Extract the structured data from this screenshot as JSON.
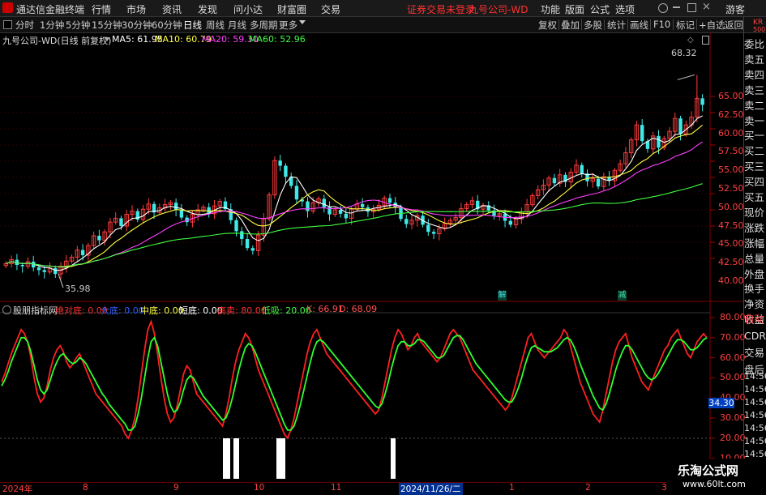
{
  "menubar": {
    "app_title": "通达信金融终端",
    "items": [
      "行情",
      "市场",
      "资讯",
      "发现",
      "问小达",
      "财富圈",
      "交易"
    ],
    "center_notice": "证券交易未登录",
    "center_stock": "九号公司-WD",
    "right_items": [
      "功能",
      "版面",
      "公式",
      "选项"
    ],
    "guest": "游客"
  },
  "toolbar": {
    "periods": [
      "分时",
      "1分钟",
      "5分钟",
      "15分钟",
      "30分钟",
      "60分钟",
      "日线",
      "周线",
      "月线",
      "多周期",
      "更多"
    ],
    "active_period": "日线",
    "right_buttons": [
      "复权",
      "叠加",
      "多股",
      "统计",
      "画线",
      "F10",
      "标记",
      "+自选",
      "返回"
    ]
  },
  "chart_header": {
    "stock": "九号公司-WD(日线 前复权)",
    "ma": [
      {
        "label": "MA5: 61.95",
        "color": "#ffffff"
      },
      {
        "label": "MA10: 60.79",
        "color": "#ffff40"
      },
      {
        "label": "MA20: 59.30",
        "color": "#ff40ff"
      },
      {
        "label": "MA60: 52.96",
        "color": "#40ff40"
      }
    ]
  },
  "indicator_header": {
    "name": "股朋指标网",
    "items": [
      {
        "label": "绝对底: 0.00",
        "color": "#ff3030"
      },
      {
        "label": "大底: 0.00",
        "color": "#3060ff"
      },
      {
        "label": "中底: 0.00",
        "color": "#ffff40"
      },
      {
        "label": "短底: 0.00",
        "color": "#ffffff"
      },
      {
        "label": "高卖: 80.00",
        "color": "#ff3030"
      },
      {
        "label": "低吸: 20.00",
        "color": "#40ff40"
      },
      {
        "label": "K: 66.91",
        "color": "#ff5050"
      },
      {
        "label": "D: 68.09",
        "color": "#ff5050"
      }
    ]
  },
  "price_axis": {
    "labels": [
      "65.00",
      "62.50",
      "60.00",
      "57.50",
      "55.00",
      "52.50",
      "50.00",
      "47.50",
      "45.00",
      "42.50",
      "40.00"
    ],
    "max_price_label": "68.32",
    "min_price_label": "35.98"
  },
  "indicator_axis": {
    "labels": [
      "80.00",
      "70.00",
      "60.00",
      "50.00",
      "40.00",
      "30.00",
      "20.00",
      "10.00"
    ],
    "current_value": "34.30"
  },
  "x_axis": {
    "labels": [
      "2024年",
      "8",
      "9",
      "10",
      "11",
      "2024/11/26/二",
      "1",
      "2",
      "3"
    ]
  },
  "event_marks": [
    "解",
    "减"
  ],
  "side_panel": {
    "top_code": "KR",
    "top_sub": "500",
    "items": [
      "委比",
      "卖五",
      "卖四",
      "卖三",
      "卖二",
      "卖一",
      "买一",
      "买二",
      "买三",
      "买四",
      "买五",
      "现价",
      "涨跌",
      "涨幅",
      "总量",
      "外盘",
      "换手",
      "净资",
      "收益"
    ],
    "lower": [
      "自动",
      "CDR",
      "交易",
      "盘后"
    ],
    "times": [
      "14:56",
      "14:56",
      "14:56",
      "14:56",
      "14:56",
      "14:56",
      "14:56",
      "14:56"
    ]
  },
  "watermark": {
    "title": "乐淘公式网",
    "url": "www.60lt.com"
  },
  "chart_data": {
    "type": "candlestick",
    "price_range": [
      35.98,
      68.32
    ],
    "candles_close": [
      39.2,
      39.8,
      39.0,
      38.8,
      39.5,
      38.6,
      38.2,
      37.9,
      38.5,
      37.6,
      38.8,
      39.6,
      40.2,
      41.3,
      40.5,
      42.0,
      43.5,
      42.8,
      44.1,
      45.6,
      46.2,
      45.0,
      46.8,
      47.3,
      46.0,
      47.6,
      48.4,
      47.1,
      47.8,
      48.3,
      48.6,
      47.5,
      46.3,
      45.6,
      46.8,
      47.5,
      47.9,
      46.9,
      48.1,
      48.8,
      47.6,
      45.9,
      44.2,
      43.0,
      41.6,
      41.2,
      43.6,
      46.1,
      49.8,
      55.1,
      54.3,
      52.6,
      51.2,
      49.1,
      48.8,
      47.3,
      48.6,
      49.2,
      47.9,
      46.8,
      47.5,
      46.9,
      46.2,
      47.6,
      48.4,
      47.9,
      47.2,
      47.6,
      48.2,
      49.3,
      48.6,
      47.9,
      46.1,
      45.3,
      45.9,
      46.6,
      45.2,
      44.1,
      43.8,
      44.6,
      45.4,
      45.9,
      46.3,
      47.7,
      48.3,
      48.9,
      47.6,
      48.2,
      47.4,
      46.6,
      46.9,
      45.8,
      45.2,
      46.1,
      47.2,
      48.3,
      49.7,
      50.6,
      51.3,
      52.4,
      51.6,
      52.9,
      51.8,
      53.3,
      54.4,
      53.1,
      51.9,
      52.3,
      51.1,
      52.6,
      52.0,
      53.6,
      54.6,
      56.3,
      58.3,
      60.6,
      58.1,
      56.9,
      58.9,
      57.1,
      58.5,
      59.6,
      61.6,
      59.2,
      60.6,
      61.8,
      64.7,
      63.7
    ],
    "indicator_range": [
      10,
      80
    ],
    "k_values": [
      48,
      52,
      57,
      62,
      66,
      70,
      74,
      72,
      68,
      60,
      50,
      42,
      38,
      40,
      46,
      54,
      60,
      64,
      66,
      63,
      58,
      55,
      57,
      60,
      62,
      58,
      54,
      50,
      46,
      42,
      40,
      38,
      36,
      34,
      32,
      30,
      28,
      26,
      22,
      20,
      24,
      30,
      40,
      52,
      64,
      74,
      78,
      72,
      62,
      50,
      40,
      32,
      28,
      30,
      36,
      44,
      52,
      56,
      54,
      48,
      42,
      40,
      38,
      36,
      34,
      32,
      30,
      28,
      26,
      32,
      40,
      50,
      58,
      64,
      68,
      72,
      70,
      66,
      60,
      54,
      50,
      46,
      42,
      38,
      34,
      30,
      26,
      22,
      20,
      24,
      30,
      38,
      46,
      54,
      62,
      68,
      72,
      74,
      70,
      66,
      62,
      60,
      58,
      56,
      54,
      52,
      50,
      48,
      46,
      44,
      42,
      40,
      38,
      36,
      34,
      32,
      34,
      40,
      48,
      56,
      64,
      70,
      74,
      72,
      68,
      64,
      66,
      70,
      72,
      68,
      66,
      64,
      62,
      60,
      58,
      60,
      64,
      68,
      72,
      74,
      72,
      70,
      66,
      62,
      58,
      54,
      52,
      50,
      48,
      46,
      44,
      42,
      40,
      38,
      36,
      34,
      36,
      40,
      46,
      52,
      58,
      64,
      70,
      72,
      68,
      64,
      62,
      60,
      62,
      64,
      66,
      68,
      70,
      74,
      72,
      66,
      60,
      54,
      48,
      44,
      40,
      36,
      32,
      30,
      28,
      34,
      42,
      50,
      58,
      64,
      68,
      70,
      72,
      66,
      60,
      56,
      52,
      48,
      46,
      44,
      48,
      52,
      56,
      60,
      64,
      66,
      70,
      72,
      74,
      70,
      66,
      62,
      60,
      64,
      68,
      70,
      72,
      70
    ],
    "d_values": [
      46,
      49,
      53,
      58,
      62,
      66,
      70,
      70,
      68,
      63,
      56,
      49,
      44,
      42,
      44,
      49,
      54,
      58,
      61,
      62,
      60,
      58,
      57,
      58,
      60,
      59,
      57,
      54,
      51,
      48,
      45,
      42,
      40,
      37,
      35,
      33,
      31,
      29,
      27,
      24,
      24,
      26,
      32,
      40,
      50,
      60,
      68,
      70,
      66,
      58,
      50,
      42,
      36,
      33,
      34,
      38,
      44,
      49,
      51,
      50,
      47,
      44,
      41,
      39,
      37,
      35,
      33,
      31,
      29,
      30,
      34,
      40,
      47,
      54,
      60,
      65,
      67,
      66,
      63,
      59,
      55,
      51,
      47,
      43,
      39,
      35,
      31,
      27,
      24,
      24,
      26,
      31,
      37,
      44,
      51,
      58,
      64,
      68,
      69,
      68,
      66,
      64,
      62,
      60,
      58,
      56,
      54,
      52,
      50,
      48,
      46,
      44,
      42,
      40,
      38,
      36,
      35,
      37,
      42,
      48,
      55,
      61,
      66,
      68,
      68,
      66,
      66,
      67,
      69,
      69,
      68,
      66,
      64,
      62,
      60,
      60,
      61,
      64,
      67,
      70,
      71,
      71,
      69,
      66,
      63,
      60,
      57,
      55,
      53,
      51,
      49,
      47,
      45,
      43,
      41,
      39,
      38,
      38,
      41,
      45,
      50,
      56,
      61,
      65,
      66,
      65,
      64,
      63,
      63,
      63,
      64,
      65,
      67,
      69,
      70,
      69,
      66,
      62,
      57,
      53,
      49,
      45,
      41,
      38,
      35,
      34,
      37,
      42,
      48,
      54,
      59,
      63,
      66,
      66,
      64,
      61,
      58,
      55,
      52,
      50,
      49,
      50,
      52,
      55,
      58,
      61,
      64,
      67,
      69,
      69,
      68,
      66,
      64,
      64,
      65,
      67,
      69,
      70
    ]
  }
}
